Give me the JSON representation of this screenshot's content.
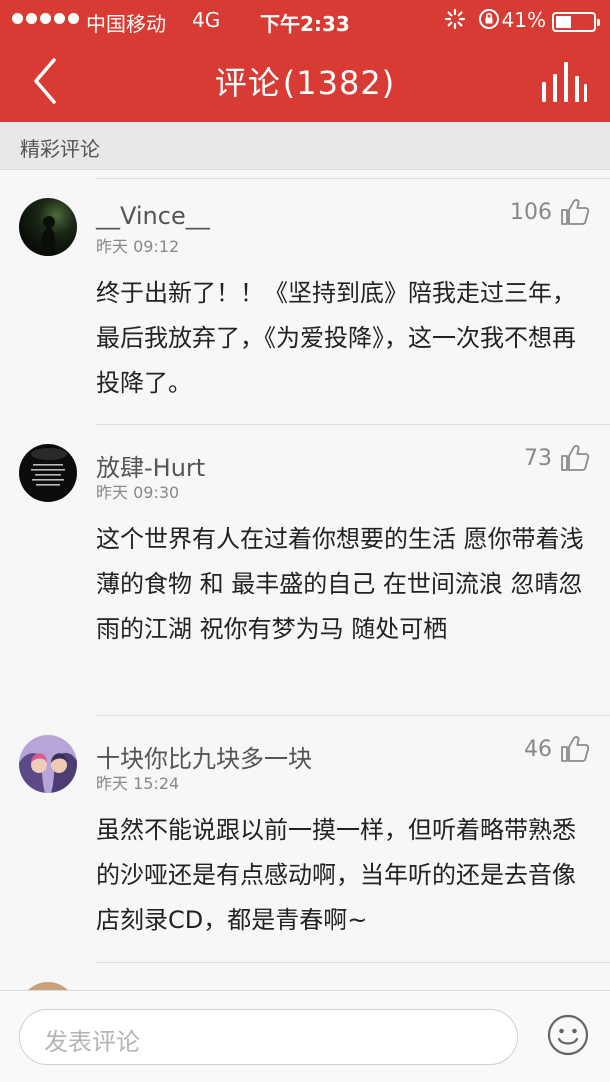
{
  "status_bar": {
    "carrier": "中国移动",
    "network": "4G",
    "time": "下午2:33",
    "battery_text": "41%",
    "battery_level": 0.41,
    "icons": [
      "loading-icon",
      "rotation-lock-icon",
      "battery-icon"
    ]
  },
  "nav": {
    "title": "评论",
    "count": "(1382)",
    "back_icon": "back-chevron-icon",
    "right_icon": "bars-chart-icon"
  },
  "section": {
    "title": "精彩评论"
  },
  "comments": [
    {
      "username": "__Vince__",
      "time": "昨天 09:12",
      "likes": "106",
      "text": "终于出新了！！《坚持到底》陪我走过三年，最后我放弃了，《为爱投降》，这一次我不想再投降了。"
    },
    {
      "username": "放肆-Hurt",
      "time": "昨天 09:30",
      "likes": "73",
      "text": "这个世界有人在过着你想要的生活 愿你带着浅薄的食物 和 最丰盛的自己 在世间流浪 忽晴忽雨的江湖 祝你有梦为马 随处可栖"
    },
    {
      "username": "十块你比九块多一块",
      "time": "昨天 15:24",
      "likes": "46",
      "text": "虽然不能说跟以前一摸一样，但听着略带熟悉的沙哑还是有点感动啊，当年听的还是去音像店刻录CD，都是青春啊~"
    }
  ],
  "input": {
    "placeholder": "发表评论",
    "emoji_icon": "smiley-face-icon"
  },
  "colors": {
    "header": "#d83b33",
    "background": "#f7f7f8",
    "section_bg": "#e8e8ea",
    "text": "#222222",
    "muted": "#888888"
  }
}
